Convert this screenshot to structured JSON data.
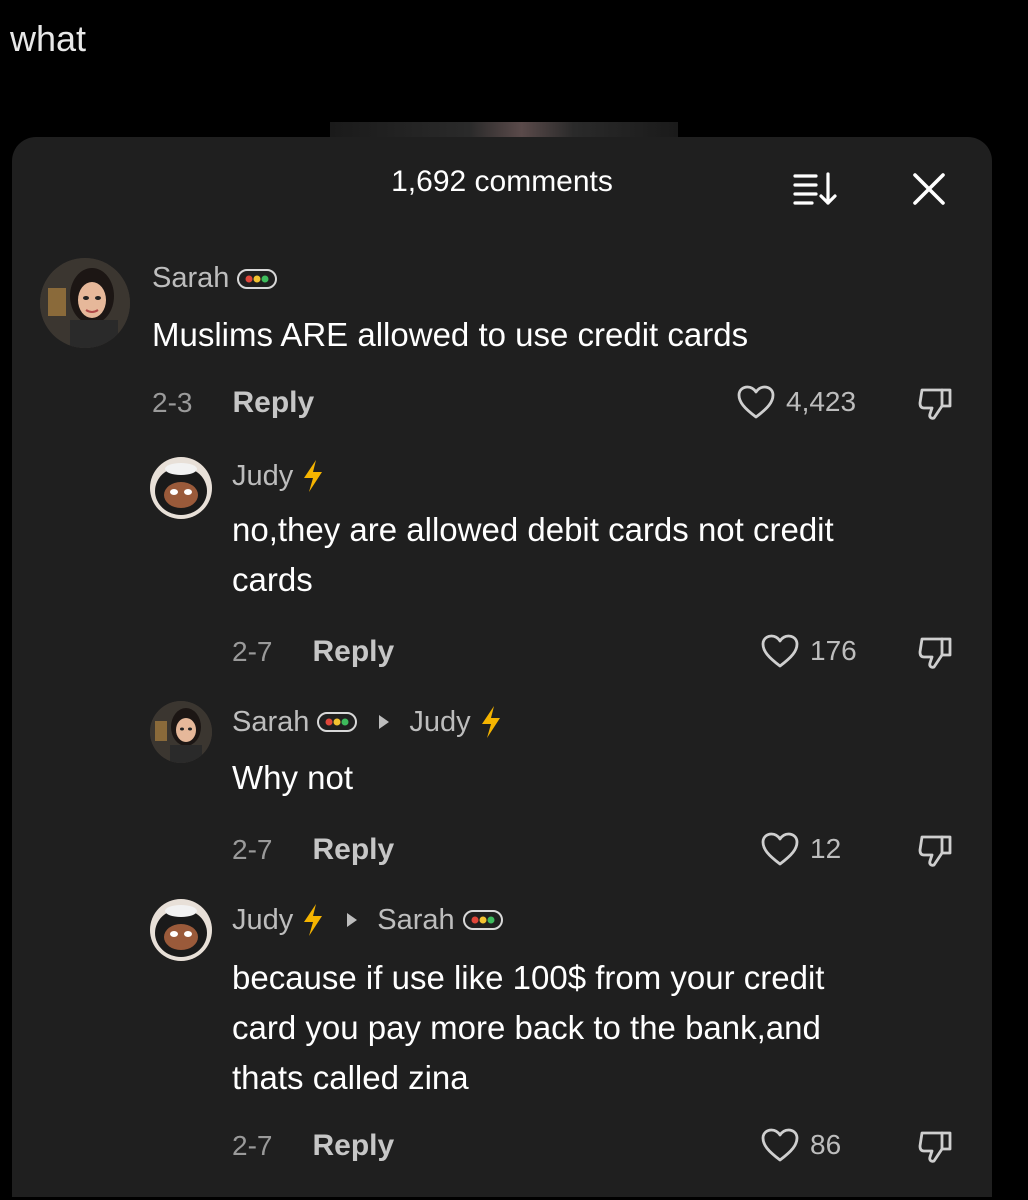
{
  "caption": "what",
  "sheet": {
    "comment_count": "1,692 comments"
  },
  "comments": [
    {
      "user": "Sarah",
      "text_lines": [
        "Muslims ARE allowed to use credit cards"
      ],
      "date": "2-3",
      "reply_label": "Reply",
      "likes": "4,423"
    },
    {
      "user": "Judy",
      "text_lines": [
        "no,they are allowed debit cards not credit",
        "cards"
      ],
      "date": "2-7",
      "reply_label": "Reply",
      "likes": "176"
    },
    {
      "user": "Sarah",
      "reply_to": "Judy",
      "text_lines": [
        "Why not"
      ],
      "date": "2-7",
      "reply_label": "Reply",
      "likes": "12"
    },
    {
      "user": "Judy",
      "reply_to": "Sarah",
      "text_lines": [
        "because if use like 100$ from your credit",
        "card you pay more back to the bank,and",
        "thats called zina"
      ],
      "date": "2-7",
      "reply_label": "Reply",
      "likes": "86"
    }
  ],
  "colors": {
    "sheet_bg": "#1f1f1f",
    "bolt": "#f5b400",
    "badge_red": "#e0463a",
    "badge_yellow": "#f2c230",
    "badge_green": "#3dbb5c"
  },
  "icons": [
    "sort-icon",
    "close-icon",
    "heart-icon",
    "dislike-icon",
    "lightning-icon",
    "badge-icon",
    "reply-arrow-icon"
  ]
}
